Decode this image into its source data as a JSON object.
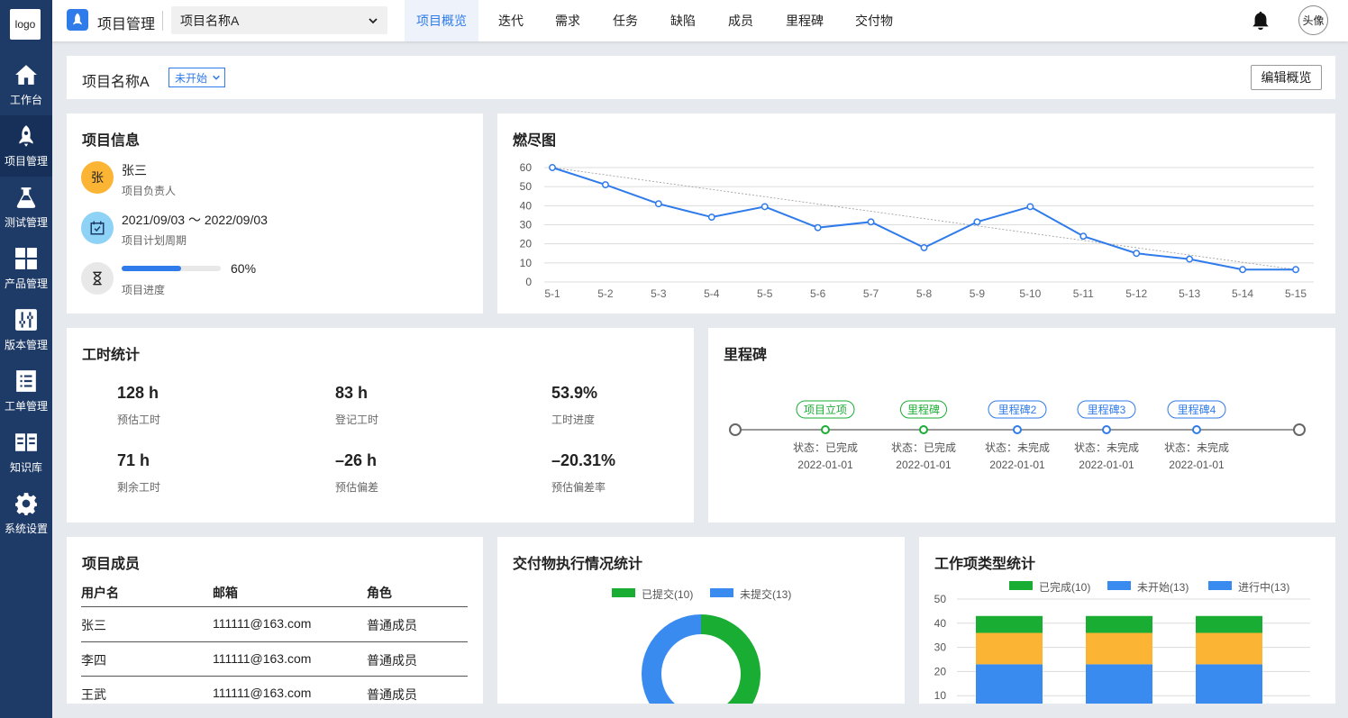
{
  "sidebar": {
    "logo": "logo",
    "items": [
      {
        "label": "工作台",
        "icon": "home-icon"
      },
      {
        "label": "项目管理",
        "icon": "rocket-icon",
        "active": true
      },
      {
        "label": "测试管理",
        "icon": "flask-icon"
      },
      {
        "label": "产品管理",
        "icon": "grid-icon"
      },
      {
        "label": "版本管理",
        "icon": "sliders-icon"
      },
      {
        "label": "工单管理",
        "icon": "list-icon"
      },
      {
        "label": "知识库",
        "icon": "book-icon"
      },
      {
        "label": "系统设置",
        "icon": "gear-icon"
      }
    ]
  },
  "topbar": {
    "app_title": "项目管理",
    "project_select": "项目名称A",
    "tabs": [
      "项目概览",
      "迭代",
      "需求",
      "任务",
      "缺陷",
      "成员",
      "里程碑",
      "交付物"
    ],
    "active_tab": "项目概览",
    "avatar": "头像"
  },
  "header": {
    "project_name": "项目名称A",
    "status": "未开始",
    "edit_label": "编辑概览"
  },
  "project_info": {
    "title": "项目信息",
    "owner_avatar": "张",
    "owner_name": "张三",
    "owner_label": "项目负责人",
    "period": "2021/09/03 ～ 2022/09/03",
    "period_label": "项目计划周期",
    "progress": "60%",
    "progress_value": 0.6,
    "progress_label": "项目进度"
  },
  "burndown": {
    "title": "燃尽图",
    "chart_data": {
      "type": "line",
      "categories": [
        "5-1",
        "5-2",
        "5-3",
        "5-4",
        "5-5",
        "5-6",
        "5-7",
        "5-8",
        "5-9",
        "5-10",
        "5-11",
        "5-12",
        "5-13",
        "5-14",
        "5-15"
      ],
      "series": [
        {
          "values": [
            60,
            51,
            41,
            34,
            39.5,
            28.5,
            31.5,
            18,
            31.5,
            39.5,
            24,
            15,
            12,
            6.5,
            6.5
          ],
          "color": "#2f7bea"
        },
        {
          "values": [
            60,
            6.5
          ],
          "style": "dashed",
          "x_index": [
            0,
            14
          ],
          "color": "#999999"
        }
      ],
      "yticks": [
        0,
        10,
        20,
        30,
        40,
        50,
        60
      ],
      "ylim": [
        0,
        60
      ],
      "grid": true
    }
  },
  "work_hours": {
    "title": "工时统计",
    "stats": [
      {
        "value": "128 h",
        "label": "预估工时"
      },
      {
        "value": "83 h",
        "label": "登记工时"
      },
      {
        "value": "53.9%",
        "label": "工时进度"
      },
      {
        "value": "71 h",
        "label": "剩余工时"
      },
      {
        "value": "–26 h",
        "label": "预估偏差"
      },
      {
        "value": "–20.31%",
        "label": "预估偏差率"
      }
    ]
  },
  "milestones": {
    "title": "里程碑",
    "items": [
      {
        "name": "项目立项",
        "status": "状态：已完成",
        "date": "2022-01-01",
        "done": true
      },
      {
        "name": "里程碑",
        "status": "状态：已完成",
        "date": "2022-01-01",
        "done": true
      },
      {
        "name": "里程碑2",
        "status": "状态：未完成",
        "date": "2022-01-01",
        "done": false
      },
      {
        "name": "里程碑3",
        "status": "状态：未完成",
        "date": "2022-01-01",
        "done": false
      },
      {
        "name": "里程碑4",
        "status": "状态：未完成",
        "date": "2022-01-01",
        "done": false
      }
    ]
  },
  "members": {
    "title": "项目成员",
    "columns": [
      "用户名",
      "邮箱",
      "角色"
    ],
    "rows": [
      [
        "张三",
        "111111@163.com",
        "普通成员"
      ],
      [
        "李四",
        "111111@163.com",
        "普通成员"
      ],
      [
        "王武",
        "111111@163.com",
        "普通成员"
      ]
    ]
  },
  "deliverables": {
    "title": "交付物执行情况统计",
    "chart_data": {
      "type": "pie",
      "series": [
        {
          "name": "已提交(10)",
          "value": 10,
          "color": "#1aad34"
        },
        {
          "name": "未提交(13)",
          "value": 13,
          "color": "#3a8bf0"
        }
      ]
    }
  },
  "worktypes": {
    "title": "工作项类型统计",
    "chart_data": {
      "type": "bar",
      "stacked": true,
      "categories": [
        "",
        "",
        ""
      ],
      "legend": [
        {
          "name": "已完成(10)",
          "color": "#1aad34"
        },
        {
          "name": "未开始(13)",
          "color": "#3a8bf0"
        },
        {
          "name": "进行中(13)",
          "color": "#3a8bf0"
        }
      ],
      "series": [
        {
          "name": "blue",
          "values": [
            23,
            23,
            23
          ],
          "color": "#3a8bf0"
        },
        {
          "name": "orange",
          "values": [
            13,
            13,
            13
          ],
          "color": "#fbb433"
        },
        {
          "name": "green",
          "values": [
            7,
            7,
            7
          ],
          "color": "#1aad34"
        }
      ],
      "yticks": [
        10,
        20,
        30,
        40,
        50
      ],
      "ylim": [
        0,
        50
      ]
    }
  }
}
